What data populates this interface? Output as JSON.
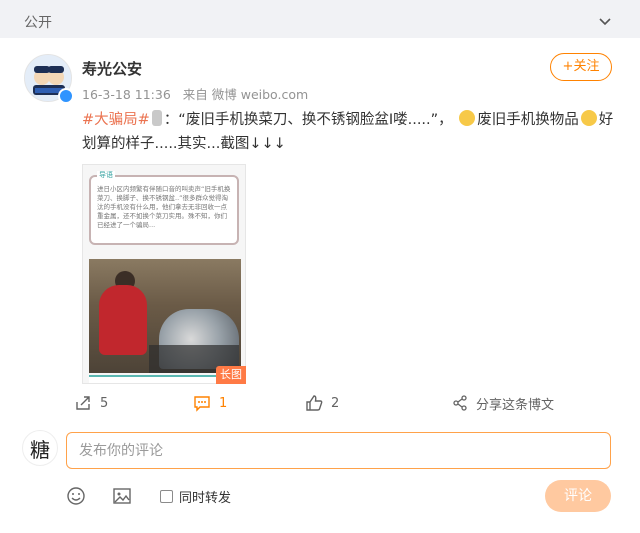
{
  "header": {
    "visibility_label": "公开"
  },
  "post": {
    "author": "寿光公安",
    "date": "16-3-18 11:36",
    "source": "来自 微博 weibo.com",
    "follow_label": "+关注",
    "topic": "#大骗局#",
    "text_part1": "：“废旧手机换菜刀、换不锈钢脸盆I喽.....”，",
    "text_part2": "废旧手机换物品",
    "text_part3": "好划算的样子.....其实...截图↓↓↓",
    "image_quote_title": "导语",
    "image_quote_text": "进日小区内频繁有伴随口音的叫卖声“旧手机换菜刀、换脚子、换不锈钢盆..”很多群众觉得淘汰的手机没有什么用，他们拿去无非回收一点重金属，还不如换个菜刀实用。殊不知，你们已经进了一个骗局...",
    "long_image_badge": "长图"
  },
  "actions": {
    "share_count": "5",
    "comment_count": "1",
    "like_count": "2",
    "share_post_label": "分享这条博文"
  },
  "comment": {
    "avatar_text": "糖",
    "placeholder": "发布你的评论",
    "repost_label": "同时转发",
    "submit_label": "评论"
  }
}
